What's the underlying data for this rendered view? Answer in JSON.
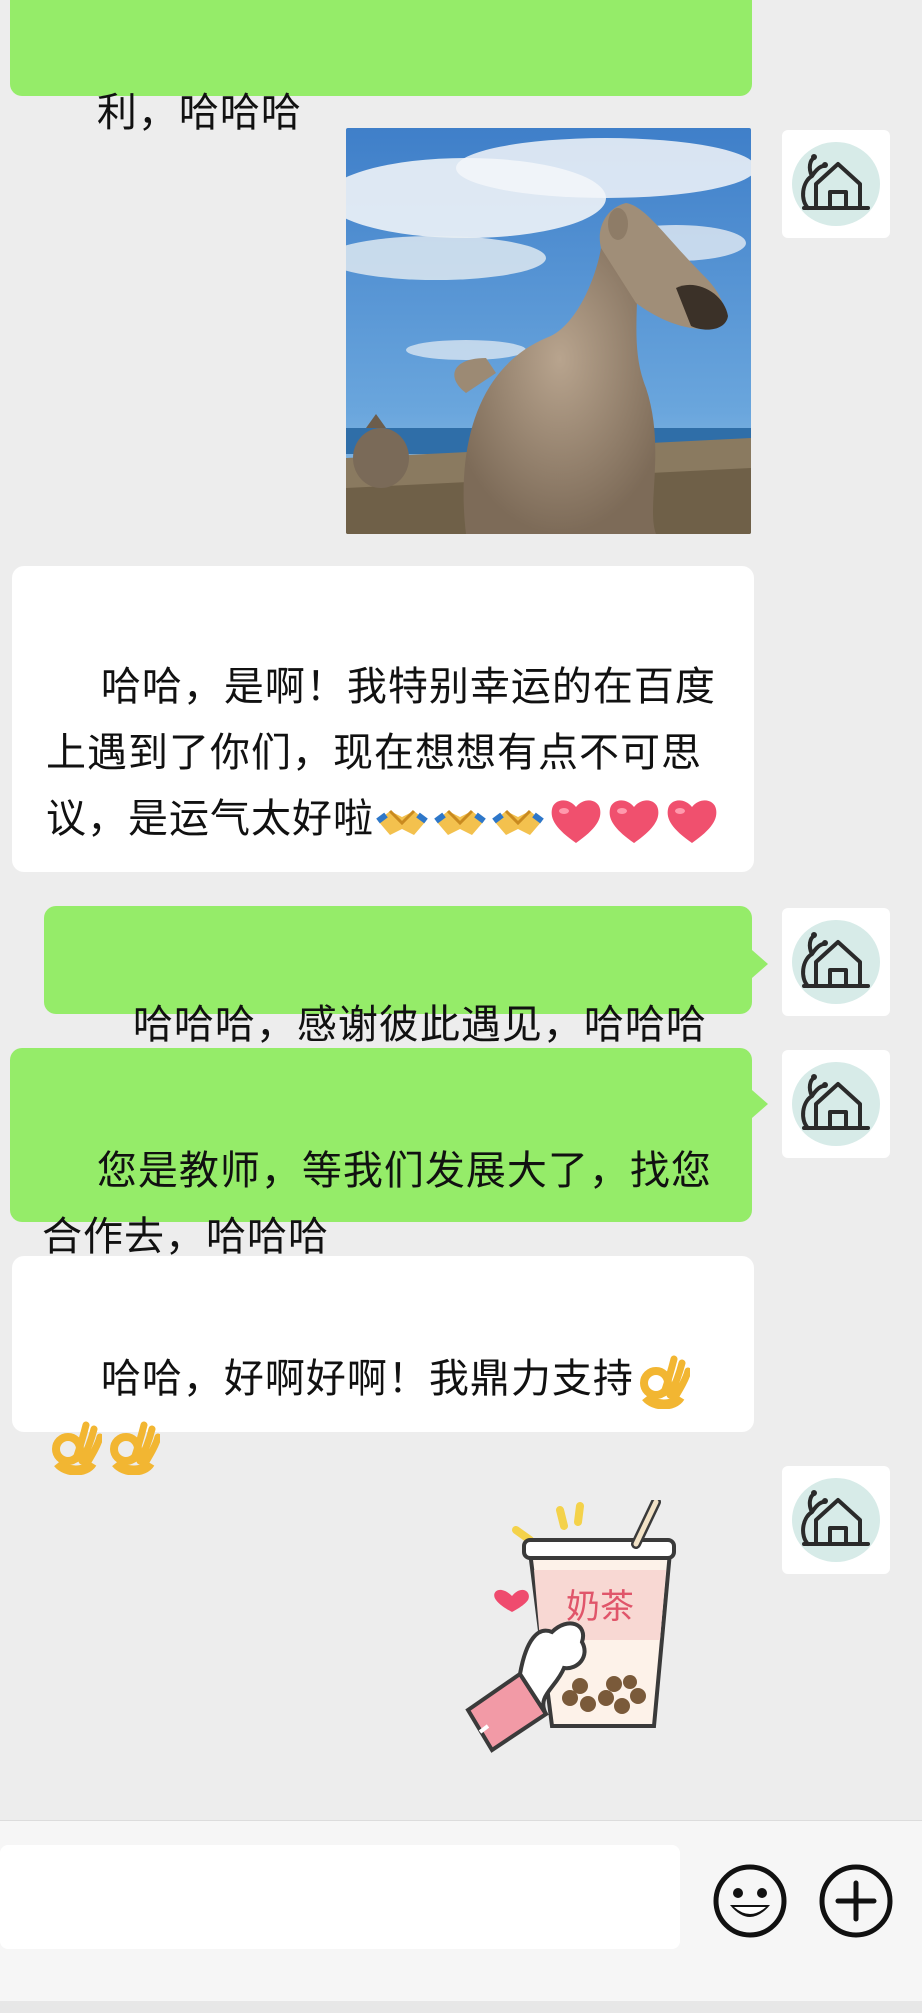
{
  "messages": [
    {
      "id": 1,
      "side": "right",
      "type": "text",
      "text": "利，哈哈哈"
    },
    {
      "id": 2,
      "side": "right",
      "type": "image",
      "description": "kangaroo-photo"
    },
    {
      "id": 3,
      "side": "left",
      "type": "text",
      "text": "哈哈，是啊！我特别幸运的在百度上遇到了你们，现在想想有点不可思议，是运气太好啦",
      "trailing_emojis": [
        "handshake",
        "handshake",
        "handshake",
        "heart",
        "heart",
        "heart"
      ]
    },
    {
      "id": 4,
      "side": "right",
      "type": "text",
      "text": "哈哈哈，感谢彼此遇见，哈哈哈"
    },
    {
      "id": 5,
      "side": "right",
      "type": "text",
      "text": "您是教师，等我们发展大了，找您合作去，哈哈哈"
    },
    {
      "id": 6,
      "side": "left",
      "type": "text",
      "text": "哈哈，好啊好啊！我鼎力支持",
      "trailing_emojis": [
        "ok-hand",
        "ok-hand",
        "ok-hand"
      ]
    },
    {
      "id": 7,
      "side": "right",
      "type": "sticker",
      "sticker_text": "奶茶"
    }
  ],
  "input": {
    "value": "",
    "placeholder": ""
  },
  "icons": {
    "emoji_button": "smiley-icon",
    "more_button": "plus-circle-icon",
    "avatar": "snail-house-icon"
  },
  "colors": {
    "sent_bubble": "#95ec69",
    "received_bubble": "#ffffff",
    "background": "#ededed"
  }
}
